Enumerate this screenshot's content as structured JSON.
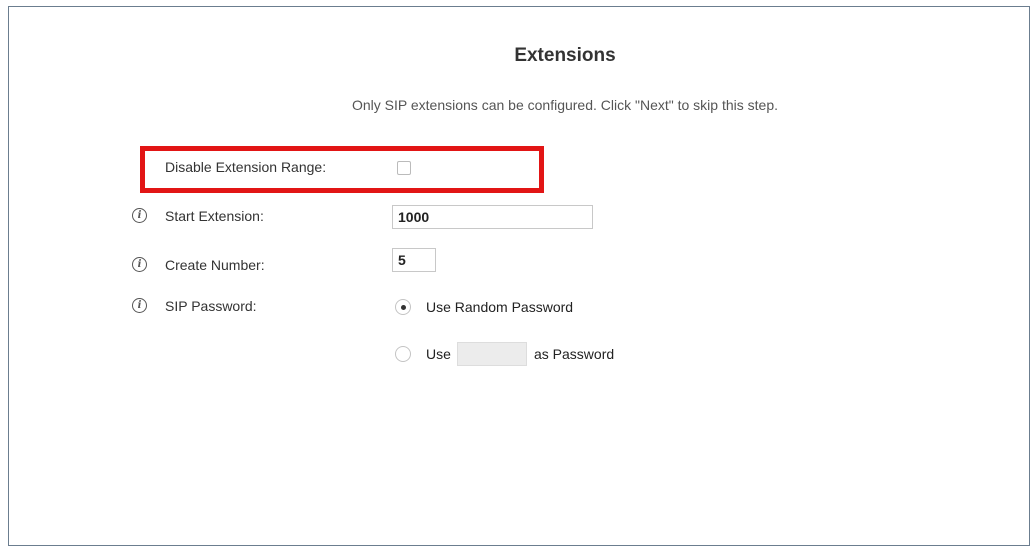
{
  "page": {
    "title": "Extensions",
    "subtitle": "Only SIP extensions can be configured. Click \"Next\" to skip this step."
  },
  "form": {
    "disable_range": {
      "label": "Disable Extension Range:",
      "checked": false
    },
    "start_extension": {
      "label": "Start Extension:",
      "value": "1000"
    },
    "create_number": {
      "label": "Create Number:",
      "value": "5"
    },
    "sip_password": {
      "label": "SIP Password:",
      "option_random": "Use Random Password",
      "option_custom_prefix": "Use",
      "option_custom_suffix": "as Password",
      "custom_value": "",
      "selected": "random"
    }
  },
  "icons": {
    "info": "info-icon"
  },
  "colors": {
    "highlight": "#e21515",
    "frame_border": "#6b7d8f"
  }
}
